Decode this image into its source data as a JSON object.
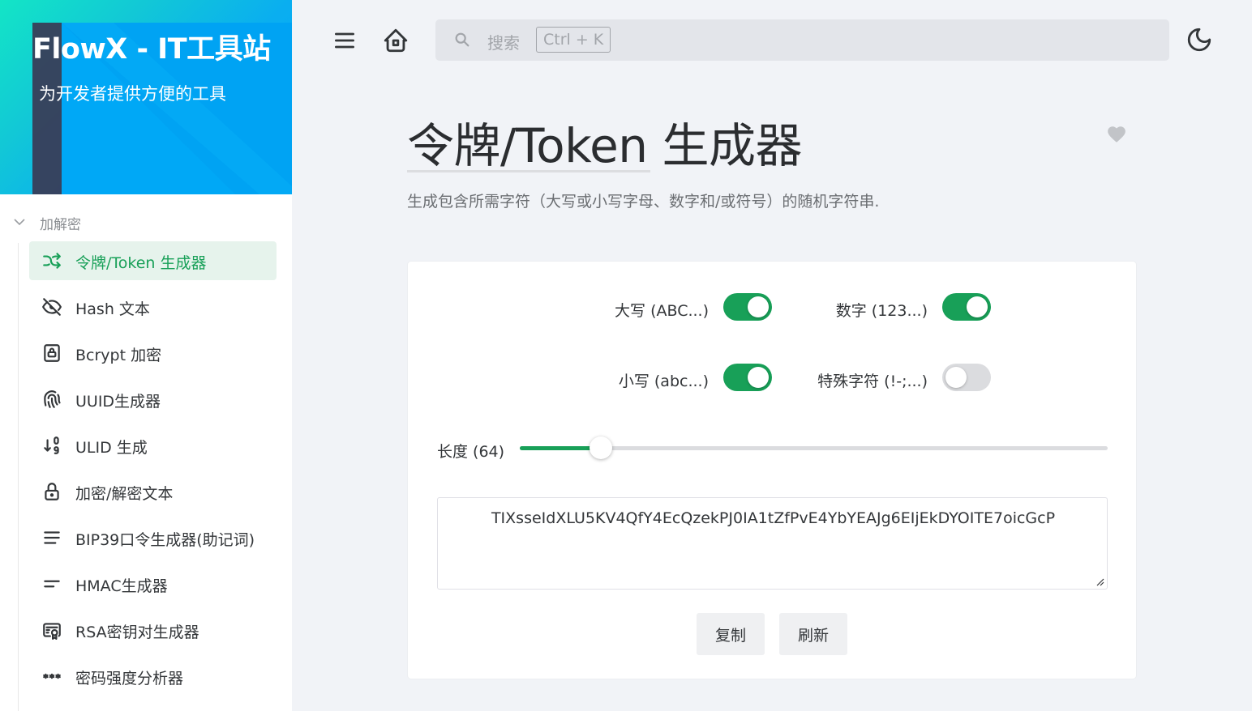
{
  "brand": {
    "title": "FlowX - IT工具站",
    "subtitle": "为开发者提供方便的工具"
  },
  "sidebar": {
    "group_label": "加解密",
    "items": [
      {
        "label": "令牌/Token 生成器",
        "icon": "shuffle-icon",
        "active": true
      },
      {
        "label": "Hash 文本",
        "icon": "eye-off-icon",
        "active": false
      },
      {
        "label": "Bcrypt 加密",
        "icon": "lock-square-icon",
        "active": false
      },
      {
        "label": "UUID生成器",
        "icon": "fingerprint-icon",
        "active": false
      },
      {
        "label": "ULID 生成",
        "icon": "sort-numeric-icon",
        "active": false
      },
      {
        "label": "加密/解密文本",
        "icon": "lock-icon",
        "active": false
      },
      {
        "label": "BIP39口令生成器(助记词)",
        "icon": "lines-icon",
        "active": false
      },
      {
        "label": "HMAC生成器",
        "icon": "short-lines-icon",
        "active": false
      },
      {
        "label": "RSA密钥对生成器",
        "icon": "certificate-icon",
        "active": false
      },
      {
        "label": "密码强度分析器",
        "icon": "password-icon",
        "active": false
      }
    ]
  },
  "header": {
    "search_placeholder": "搜索",
    "search_shortcut": "Ctrl + K"
  },
  "page": {
    "title": "令牌/Token 生成器",
    "description": "生成包含所需字符（大写或小写字母、数字和/或符号）的随机字符串."
  },
  "options": {
    "uppercase": {
      "label": "大写 (ABC...)",
      "on": true
    },
    "numbers": {
      "label": "数字 (123...)",
      "on": true
    },
    "lowercase": {
      "label": "小写 (abc...)",
      "on": true
    },
    "symbols": {
      "label": "特殊字符 (!-;...)",
      "on": false
    }
  },
  "length": {
    "label": "长度 (64)",
    "value": 64,
    "fill_fraction": 0.138
  },
  "output": {
    "token": "TIXsseIdXLU5KV4QfY4EcQzekPJ0IA1tZfPvE4YbYEAJg6EIjEkDYOITE7oicGcP"
  },
  "actions": {
    "copy_label": "复制",
    "refresh_label": "刷新"
  },
  "colors": {
    "accent": "#18a058",
    "active_bg": "#e6f3ec",
    "background": "#f1f3f7"
  }
}
